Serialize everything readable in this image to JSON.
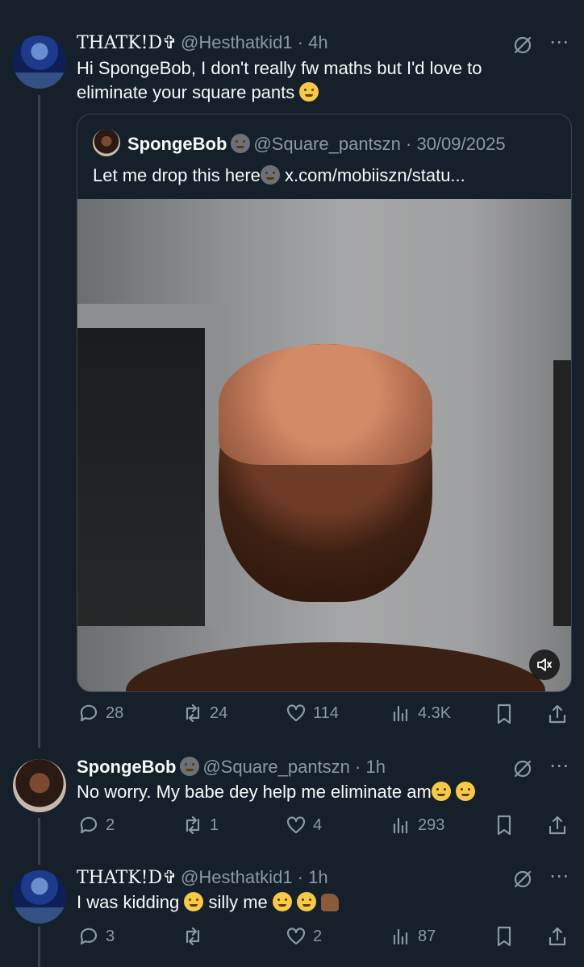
{
  "tweet1": {
    "name": "THATK!D✞",
    "handle": "@Hesthatkid1 · 4h",
    "text": "Hi SpongeBob, I don't really fw maths but I'd love to eliminate your square pants",
    "metrics": {
      "replies": "28",
      "retweets": "24",
      "likes": "114",
      "views": "4.3K"
    }
  },
  "quote": {
    "name": "SpongeBob",
    "handle": "@Square_pantszn · 30/09/2025",
    "text": "Let me drop this here",
    "link": "x.com/mobiiszn/statu..."
  },
  "tweet2": {
    "name": "SpongeBob",
    "handle": "@Square_pantszn · 1h",
    "text": "No worry. My babe dey help me eliminate am",
    "metrics": {
      "replies": "2",
      "retweets": "1",
      "likes": "4",
      "views": "293"
    }
  },
  "tweet3": {
    "name": "THATK!D✞",
    "handle": "@Hesthatkid1 · 1h",
    "text_a": "I was kidding",
    "text_b": "silly me",
    "metrics": {
      "replies": "3",
      "retweets": "",
      "likes": "2",
      "views": "87"
    }
  },
  "colors": {
    "background": "#15202b",
    "text": "#f7f9f9",
    "muted": "#8b98a5",
    "border": "#38444d"
  }
}
